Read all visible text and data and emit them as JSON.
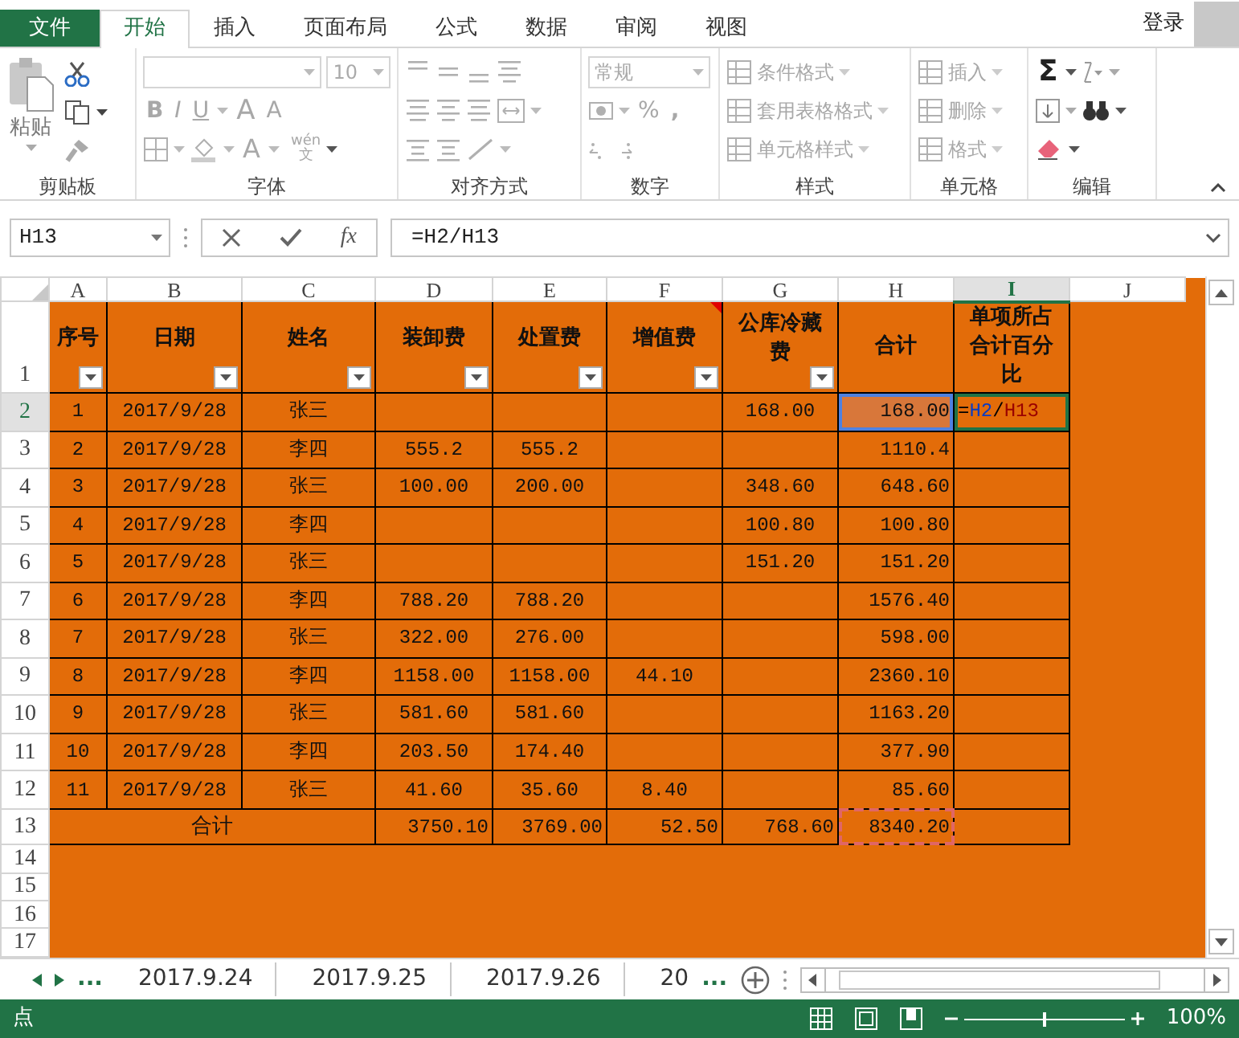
{
  "title_bar": {
    "tabs": [
      {
        "label": "文件",
        "kind": "file",
        "selected": false
      },
      {
        "label": "开始",
        "kind": "tab",
        "selected": true
      },
      {
        "label": "插入",
        "kind": "tab",
        "selected": false
      },
      {
        "label": "页面布局",
        "kind": "tab",
        "selected": false
      },
      {
        "label": "公式",
        "kind": "tab",
        "selected": false
      },
      {
        "label": "数据",
        "kind": "tab",
        "selected": false
      },
      {
        "label": "审阅",
        "kind": "tab",
        "selected": false
      },
      {
        "label": "视图",
        "kind": "tab",
        "selected": false
      }
    ],
    "account": "登录"
  },
  "ribbon": {
    "groups": [
      {
        "kind": "clipboard",
        "label": "剪贴板",
        "paste": "粘贴"
      },
      {
        "kind": "font",
        "label": "字体",
        "disabled": true,
        "font_size": "10",
        "styles": [
          "B",
          "I",
          "U"
        ],
        "grow": [
          "A",
          "A"
        ],
        "color_letter": "A",
        "phonetic": [
          "wén",
          "文"
        ]
      },
      {
        "kind": "alignment",
        "label": "对齐方式",
        "disabled": true
      },
      {
        "kind": "number",
        "label": "数字",
        "disabled": true,
        "format": "常规",
        "percent": "%",
        "comma": ","
      },
      {
        "kind": "styles",
        "label": "样式",
        "disabled": true,
        "items": [
          "条件格式",
          "套用表格格式",
          "单元格样式"
        ]
      },
      {
        "kind": "cells",
        "label": "单元格",
        "disabled": true,
        "items": [
          "插入",
          "删除",
          "格式"
        ]
      },
      {
        "kind": "editing",
        "label": "编辑",
        "sum": "Σ"
      }
    ]
  },
  "formula_bar": {
    "name_box": "H13",
    "fx": "fx",
    "formula": "=H2/H13"
  },
  "sheet": {
    "columns": [
      {
        "letter": "A",
        "selected": false
      },
      {
        "letter": "B",
        "selected": false
      },
      {
        "letter": "C",
        "selected": false
      },
      {
        "letter": "D",
        "selected": false
      },
      {
        "letter": "E",
        "selected": false
      },
      {
        "letter": "F",
        "selected": false
      },
      {
        "letter": "G",
        "selected": false
      },
      {
        "letter": "H",
        "selected": false
      },
      {
        "letter": "I",
        "selected": true
      },
      {
        "letter": "J",
        "selected": false
      }
    ],
    "header": {
      "number": "1",
      "selected": false,
      "cells": [
        {
          "text": "序号",
          "filter": true,
          "comment": false
        },
        {
          "text": "日期",
          "filter": true,
          "comment": false
        },
        {
          "text": "姓名",
          "filter": true,
          "comment": false
        },
        {
          "text": "装卸费",
          "filter": true,
          "comment": false
        },
        {
          "text": "处置费",
          "filter": true,
          "comment": false
        },
        {
          "text": "增值费",
          "filter": true,
          "comment": true
        },
        {
          "text": "公库冷藏费",
          "filter": true,
          "comment": false
        },
        {
          "text": "合计",
          "filter": false,
          "comment": false
        },
        {
          "text": "单项所占合计百分比",
          "filter": false,
          "comment": false
        }
      ]
    },
    "rows": [
      {
        "number": "2",
        "selected": true,
        "cells": [
          "1",
          "2017/9/28",
          "张三",
          null,
          null,
          null,
          "168.00",
          "168.00"
        ],
        "referenced": true,
        "editing": [
          {
            "text": "=",
            "color": "#000000"
          },
          {
            "text": "H2",
            "color": "#0b3cc1"
          },
          {
            "text": "/",
            "color": "#000000"
          },
          {
            "text": "H13",
            "color": "#9a0000"
          }
        ]
      },
      {
        "number": "3",
        "selected": false,
        "cells": [
          "2",
          "2017/9/28",
          "李四",
          "555.2",
          "555.2",
          null,
          null,
          "1110.4"
        ]
      },
      {
        "number": "4",
        "selected": false,
        "cells": [
          "3",
          "2017/9/28",
          "张三",
          "100.00",
          "200.00",
          null,
          "348.60",
          "648.60"
        ]
      },
      {
        "number": "5",
        "selected": false,
        "cells": [
          "4",
          "2017/9/28",
          "李四",
          null,
          null,
          null,
          "100.80",
          "100.80"
        ]
      },
      {
        "number": "6",
        "selected": false,
        "cells": [
          "5",
          "2017/9/28",
          "张三",
          null,
          null,
          null,
          "151.20",
          "151.20"
        ]
      },
      {
        "number": "7",
        "selected": false,
        "cells": [
          "6",
          "2017/9/28",
          "李四",
          "788.20",
          "788.20",
          null,
          null,
          "1576.40"
        ]
      },
      {
        "number": "8",
        "selected": false,
        "cells": [
          "7",
          "2017/9/28",
          "张三",
          "322.00",
          "276.00",
          null,
          null,
          "598.00"
        ]
      },
      {
        "number": "9",
        "selected": false,
        "cells": [
          "8",
          "2017/9/28",
          "李四",
          "1158.00",
          "1158.00",
          "44.10",
          null,
          "2360.10"
        ]
      },
      {
        "number": "10",
        "selected": false,
        "cells": [
          "9",
          "2017/9/28",
          "张三",
          "581.60",
          "581.60",
          null,
          null,
          "1163.20"
        ]
      },
      {
        "number": "11",
        "selected": false,
        "cells": [
          "10",
          "2017/9/28",
          "李四",
          "203.50",
          "174.40",
          null,
          null,
          "377.90"
        ]
      },
      {
        "number": "12",
        "selected": false,
        "cells": [
          "11",
          "2017/9/28",
          "张三",
          "41.60",
          "35.60",
          "8.40",
          null,
          "85.60"
        ]
      }
    ],
    "total": {
      "number": "13",
      "selected": false,
      "label": "合计",
      "cells": [
        "3750.10",
        "3769.00",
        "52.50",
        "768.60",
        "8340.20"
      ],
      "referenced": true
    },
    "empty_rows": [
      "14",
      "15",
      "16",
      "17"
    ]
  },
  "sheet_tabs": [
    {
      "label": "...",
      "kind": "more"
    },
    {
      "label": "2017.9.24",
      "kind": "sheet",
      "selected": false
    },
    {
      "label": "2017.9.25",
      "kind": "sheet",
      "selected": false
    },
    {
      "label": "2017.9.26",
      "kind": "sheet",
      "selected": false
    },
    {
      "label": "20",
      "kind": "sheet",
      "selected": false
    },
    {
      "label": "...",
      "kind": "more"
    }
  ],
  "status_bar": {
    "mode": "点",
    "zoom": "100%",
    "zoom_slider": {
      "level": 0.5
    }
  }
}
